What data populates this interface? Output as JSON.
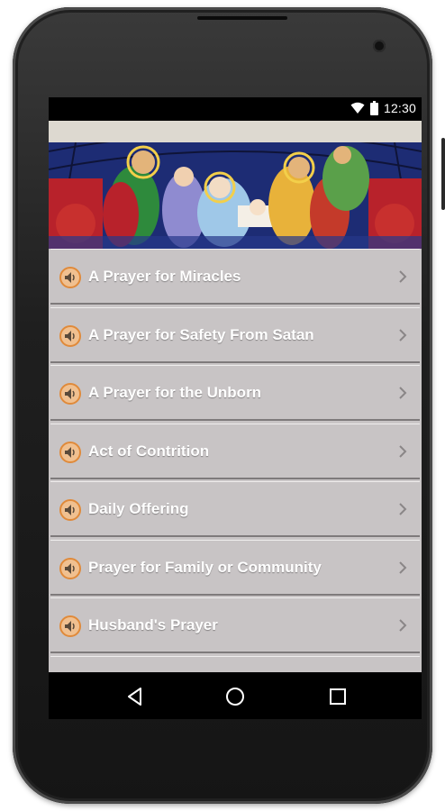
{
  "status_bar": {
    "time": "12:30",
    "icons": [
      "wifi-icon",
      "battery-icon"
    ]
  },
  "banner": {
    "image": "stained-glass-nativity",
    "colors": [
      "#1a2a6a",
      "#c0242a",
      "#e8b23a",
      "#2e8a3c",
      "#f2e0c8"
    ]
  },
  "prayers": [
    {
      "label": "A Prayer for Miracles",
      "icon": "speaker-icon"
    },
    {
      "label": "A Prayer for Safety From Satan",
      "icon": "speaker-icon"
    },
    {
      "label": "A Prayer for the Unborn",
      "icon": "speaker-icon"
    },
    {
      "label": "Act of Contrition",
      "icon": "speaker-icon"
    },
    {
      "label": "Daily Offering",
      "icon": "speaker-icon"
    },
    {
      "label": "Prayer for Family or Community",
      "icon": "speaker-icon"
    },
    {
      "label": "Husband's Prayer",
      "icon": "speaker-icon"
    }
  ],
  "nav": [
    "back-icon",
    "home-icon",
    "recents-icon"
  ],
  "colors": {
    "list_bg": "#c8c4c5",
    "label": "#ffffff",
    "speaker_accent": "#e08a3a",
    "status_bg": "#000000"
  }
}
